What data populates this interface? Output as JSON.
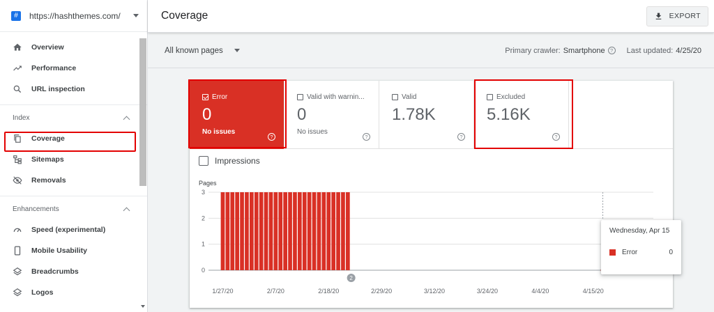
{
  "sidebar": {
    "property": "https://hashthemes.com/",
    "top_items": [
      {
        "label": "Overview",
        "icon": "home-icon"
      },
      {
        "label": "Performance",
        "icon": "trending-up-icon"
      },
      {
        "label": "URL inspection",
        "icon": "search-icon"
      }
    ],
    "index_section": {
      "title": "Index",
      "items": [
        {
          "label": "Coverage",
          "icon": "coverage-icon"
        },
        {
          "label": "Sitemaps",
          "icon": "sitemap-icon"
        },
        {
          "label": "Removals",
          "icon": "removals-icon"
        }
      ]
    },
    "enhancements_section": {
      "title": "Enhancements",
      "items": [
        {
          "label": "Speed (experimental)",
          "icon": "speed-icon"
        },
        {
          "label": "Mobile Usability",
          "icon": "mobile-icon"
        },
        {
          "label": "Breadcrumbs",
          "icon": "layers-icon"
        },
        {
          "label": "Logos",
          "icon": "layers-icon"
        }
      ]
    }
  },
  "header": {
    "title": "Coverage",
    "export_label": "EXPORT"
  },
  "filter": {
    "select": "All known pages",
    "crawler_label": "Primary crawler:",
    "crawler_value": "Smartphone",
    "updated_label": "Last updated:",
    "updated_value": "4/25/20"
  },
  "tiles": {
    "error": {
      "label": "Error",
      "value": "0",
      "sub": "No issues"
    },
    "warning": {
      "label": "Valid with warnin...",
      "value": "0",
      "sub": "No issues"
    },
    "valid": {
      "label": "Valid",
      "value": "1.78K"
    },
    "excluded": {
      "label": "Excluded",
      "value": "5.16K"
    }
  },
  "impressions_label": "Impressions",
  "annotation_marker": "2",
  "colors": {
    "error": "#d93025",
    "highlight": "#e30000"
  },
  "tooltip": {
    "date": "Wednesday, Apr 15",
    "series": "Error",
    "value": "0"
  },
  "chart_data": {
    "type": "bar",
    "ylabel": "Pages",
    "yticks": [
      0,
      1,
      2,
      3
    ],
    "ylim": [
      0,
      3
    ],
    "x_ticks": [
      "1/27/20",
      "2/7/20",
      "2/18/20",
      "2/29/20",
      "3/12/20",
      "3/24/20",
      "4/4/20",
      "4/15/20"
    ],
    "x_start": "2020-01-27",
    "num_days": 90,
    "series": [
      {
        "name": "Error",
        "color": "#d93025",
        "values": [
          3,
          3,
          3,
          3,
          3,
          3,
          3,
          3,
          3,
          3,
          3,
          3,
          3,
          3,
          3,
          3,
          3,
          3,
          3,
          3,
          3,
          3,
          3,
          3,
          3,
          3,
          3,
          0,
          0,
          0,
          0,
          0,
          0,
          0,
          0,
          0,
          0,
          0,
          0,
          0,
          0,
          0,
          0,
          0,
          0,
          0,
          0,
          0,
          0,
          0,
          0,
          0,
          0,
          0,
          0,
          0,
          0,
          0,
          0,
          0,
          0,
          0,
          0,
          0,
          0,
          0,
          0,
          0,
          0,
          0,
          0,
          0,
          0,
          0,
          0,
          0,
          0,
          0,
          0,
          0,
          0,
          0,
          0,
          0,
          0,
          0,
          0,
          0,
          0,
          0
        ]
      }
    ],
    "hover_date": "4/15/20"
  }
}
